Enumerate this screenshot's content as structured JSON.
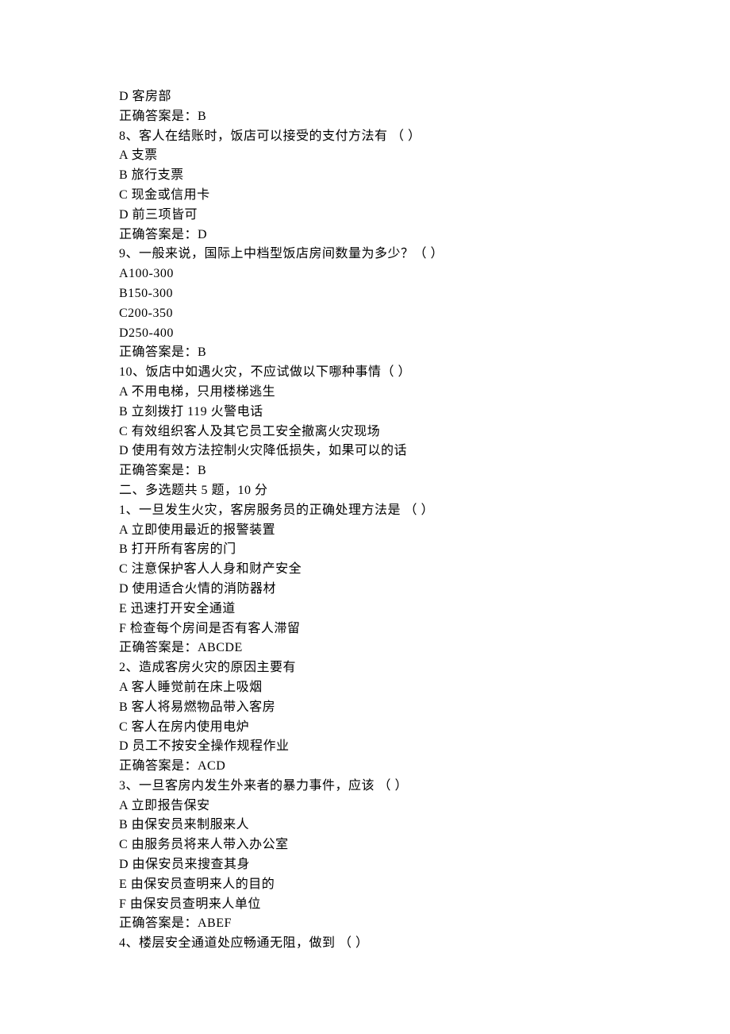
{
  "lines": [
    "D 客房部",
    "正确答案是：B",
    "8、客人在结账时，饭店可以接受的支付方法有 （ ）",
    "A 支票",
    "B 旅行支票",
    "C 现金或信用卡",
    "D 前三项皆可",
    "正确答案是：D",
    "9、一般来说，国际上中档型饭店房间数量为多少？（ ）",
    "A100-300",
    "B150-300",
    "C200-350",
    "D250-400",
    "正确答案是：B",
    "10、饭店中如遇火灾，不应试做以下哪种事情（ ）",
    "A 不用电梯，只用楼梯逃生",
    "B 立刻拨打 119 火警电话",
    "C 有效组织客人及其它员工安全撤离火灾现场",
    "D 使用有效方法控制火灾降低损失，如果可以的话",
    "正确答案是：B",
    "二、多选题共 5 题，10 分",
    "1、一旦发生火灾，客房服务员的正确处理方法是 （ ）",
    "A 立即使用最近的报警装置",
    "B 打开所有客房的门",
    "C 注意保护客人人身和财产安全",
    "D 使用适合火情的消防器材",
    "E 迅速打开安全通道",
    "F 检查每个房间是否有客人滞留",
    "正确答案是：ABCDE",
    "2、造成客房火灾的原因主要有",
    "A 客人睡觉前在床上吸烟",
    "B 客人将易燃物品带入客房",
    "C 客人在房内使用电炉",
    "D 员工不按安全操作规程作业",
    "正确答案是：ACD",
    "3、一旦客房内发生外来者的暴力事件，应该 （ ）",
    "A 立即报告保安",
    "B 由保安员来制服来人",
    "C 由服务员将来人带入办公室",
    "D 由保安员来搜查其身",
    "E 由保安员查明来人的目的",
    "F 由保安员查明来人单位",
    "正确答案是：ABEF",
    "4、楼层安全通道处应畅通无阻，做到 （ ）"
  ]
}
